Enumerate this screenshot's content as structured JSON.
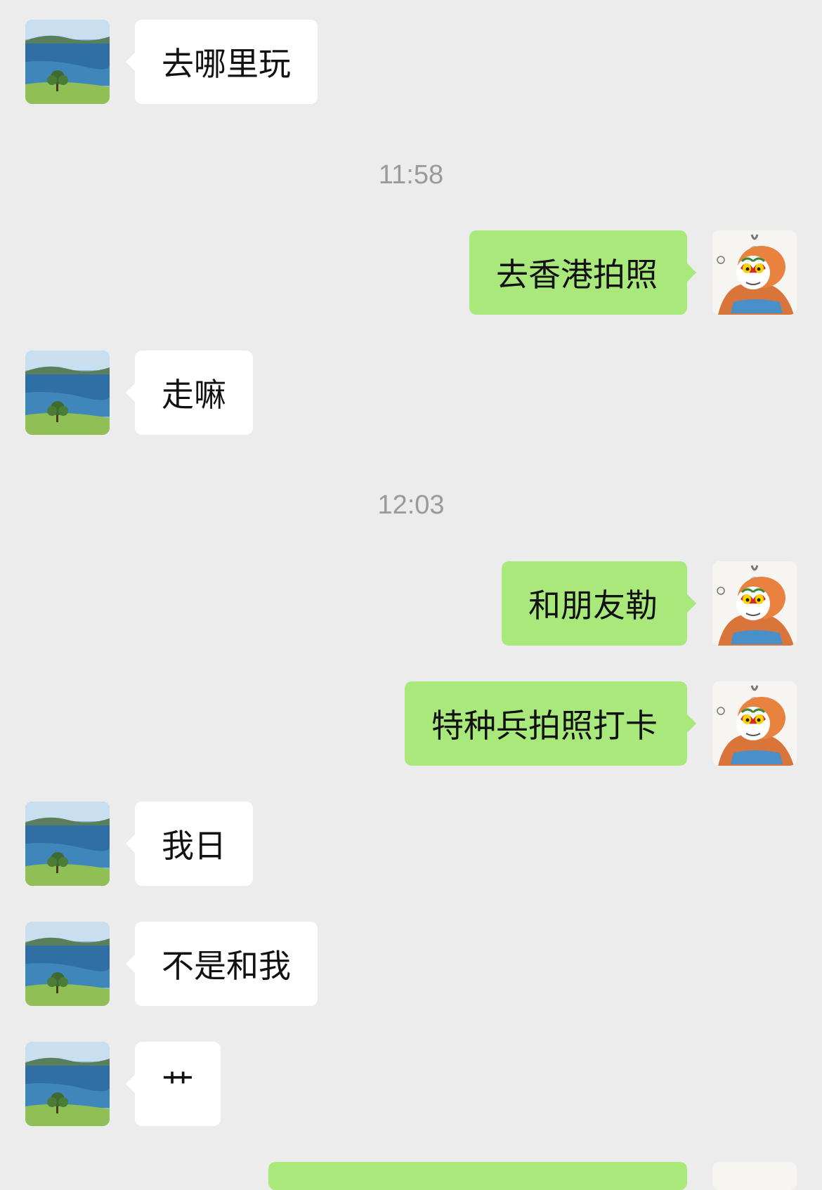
{
  "chat": {
    "messages": [
      {
        "side": "in",
        "text": "去哪里玩"
      },
      {
        "time": "11:58"
      },
      {
        "side": "out",
        "text": "去香港拍照"
      },
      {
        "side": "in",
        "text": "走嘛"
      },
      {
        "time": "12:03"
      },
      {
        "side": "out",
        "text": "和朋友勒"
      },
      {
        "side": "out",
        "text": "特种兵拍照打卡"
      },
      {
        "side": "in",
        "text": "我日"
      },
      {
        "side": "in",
        "text": "不是和我"
      },
      {
        "side": "in",
        "text": "艹"
      }
    ]
  },
  "colors": {
    "background": "#ececec",
    "incoming_bubble": "#ffffff",
    "outgoing_bubble": "#a9e97b",
    "timestamp": "#9a9a9a"
  },
  "icons": {
    "incoming_avatar": "lake-landscape-avatar-icon",
    "outgoing_avatar": "monkey-king-avatar-icon"
  }
}
